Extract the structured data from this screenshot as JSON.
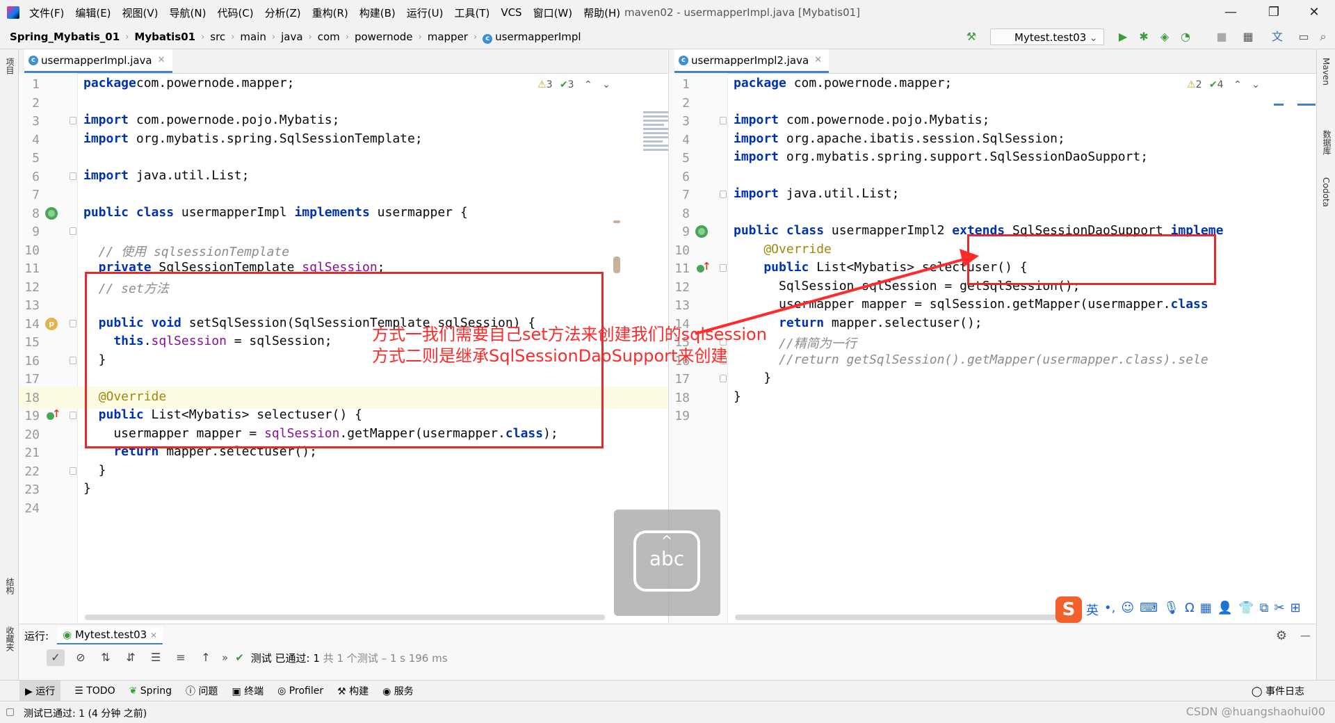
{
  "menubar": {
    "items": [
      "文件(F)",
      "编辑(E)",
      "视图(V)",
      "导航(N)",
      "代码(C)",
      "分析(Z)",
      "重构(R)",
      "构建(B)",
      "运行(U)",
      "工具(T)",
      "VCS",
      "窗口(W)",
      "帮助(H)"
    ],
    "title": "maven02 - usermapperImpl.java [Mybatis01]",
    "minimize": "—",
    "maximize": "❐",
    "close": "✕"
  },
  "breadcrumb": [
    "Spring_Mybatis_01",
    "Mybatis01",
    "src",
    "main",
    "java",
    "com",
    "powernode",
    "mapper",
    "usermapperImpl"
  ],
  "run_config": "Mytest.test03",
  "left_editor": {
    "tab": "usermapperImpl.java",
    "inspections": {
      "warnings": "3",
      "weak": "3"
    },
    "lines": [
      {
        "n": "1",
        "t": [
          [
            "kw",
            "package"
          ],
          [
            "",
            "com.powernode.mapper;"
          ]
        ]
      },
      {
        "n": "2",
        "t": []
      },
      {
        "n": "3",
        "t": [
          [
            "kw",
            "import"
          ],
          [
            "",
            " com.powernode.pojo.Mybatis;"
          ]
        ]
      },
      {
        "n": "4",
        "t": [
          [
            "kw",
            "import"
          ],
          [
            "",
            " org.mybatis.spring.SqlSessionTemplate;"
          ]
        ]
      },
      {
        "n": "5",
        "t": []
      },
      {
        "n": "6",
        "t": [
          [
            "kw",
            "import"
          ],
          [
            "",
            " java.util.List;"
          ]
        ]
      },
      {
        "n": "7",
        "t": []
      },
      {
        "n": "8",
        "t": [
          [
            "kw",
            "public class"
          ],
          [
            "",
            " usermapperImpl "
          ],
          [
            "kw",
            "implements"
          ],
          [
            "",
            " usermapper {"
          ]
        ]
      },
      {
        "n": "9",
        "t": []
      },
      {
        "n": "10",
        "t": [
          [
            "cm",
            "  // 使用 sqlsessionTemplate"
          ]
        ]
      },
      {
        "n": "11",
        "t": [
          [
            "kw",
            "  private"
          ],
          [
            "",
            " SqlSessionTemplate "
          ],
          [
            "fld",
            "sqlSession"
          ],
          [
            "",
            ";"
          ]
        ]
      },
      {
        "n": "12",
        "t": [
          [
            "cm",
            "  // set方法"
          ]
        ]
      },
      {
        "n": "13",
        "t": []
      },
      {
        "n": "14",
        "t": [
          [
            "kw",
            "  public void"
          ],
          [
            "",
            " setSqlSession(SqlSessionTemplate sqlSession) {"
          ]
        ]
      },
      {
        "n": "15",
        "t": [
          [
            "kw",
            "    this"
          ],
          [
            "",
            "."
          ],
          [
            "fld",
            "sqlSession"
          ],
          [
            "",
            " = sqlSession;"
          ]
        ]
      },
      {
        "n": "16",
        "t": [
          [
            "",
            "  }"
          ]
        ]
      },
      {
        "n": "17",
        "t": []
      },
      {
        "n": "18",
        "t": [
          [
            "an",
            "  @Override"
          ]
        ]
      },
      {
        "n": "19",
        "t": [
          [
            "kw",
            "  public"
          ],
          [
            "",
            " List<Mybatis> selectuser() {"
          ]
        ]
      },
      {
        "n": "20",
        "t": [
          [
            "",
            "    usermapper mapper = "
          ],
          [
            "fld",
            "sqlSession"
          ],
          [
            "",
            ".getMapper(usermapper."
          ],
          [
            "kw",
            "class"
          ],
          [
            "",
            ");"
          ]
        ]
      },
      {
        "n": "21",
        "t": [
          [
            "kw",
            "    return"
          ],
          [
            "",
            " mapper.selectuser();"
          ]
        ]
      },
      {
        "n": "22",
        "t": [
          [
            "",
            "  }"
          ]
        ]
      },
      {
        "n": "23",
        "t": [
          [
            "",
            "}"
          ]
        ]
      },
      {
        "n": "24",
        "t": []
      }
    ]
  },
  "right_editor": {
    "tab": "usermapperImpl2.java",
    "inspections": {
      "warnings": "2",
      "weak": "4"
    },
    "lines": [
      {
        "n": "1",
        "t": [
          [
            "kw",
            "package"
          ],
          [
            "",
            " com.powernode.mapper;"
          ]
        ]
      },
      {
        "n": "2",
        "t": []
      },
      {
        "n": "3",
        "t": [
          [
            "kw",
            "import"
          ],
          [
            "",
            " com.powernode.pojo.Mybatis;"
          ]
        ]
      },
      {
        "n": "4",
        "t": [
          [
            "kw",
            "import"
          ],
          [
            "",
            " org.apache.ibatis.session.SqlSession;"
          ]
        ]
      },
      {
        "n": "5",
        "t": [
          [
            "kw",
            "import"
          ],
          [
            "",
            " org.mybatis.spring.support.SqlSessionDaoSupport;"
          ]
        ]
      },
      {
        "n": "6",
        "t": []
      },
      {
        "n": "7",
        "t": [
          [
            "kw",
            "import"
          ],
          [
            "",
            " java.util.List;"
          ]
        ]
      },
      {
        "n": "8",
        "t": []
      },
      {
        "n": "9",
        "t": [
          [
            "kw",
            "public class"
          ],
          [
            "",
            " usermapperImpl2 "
          ],
          [
            "kw",
            "extends"
          ],
          [
            "",
            " SqlSessionDaoSupport "
          ],
          [
            "kw",
            "impleme"
          ]
        ]
      },
      {
        "n": "10",
        "t": [
          [
            "an",
            "    @Override"
          ]
        ]
      },
      {
        "n": "11",
        "t": [
          [
            "kw",
            "    public"
          ],
          [
            "",
            " List<Mybatis> selectuser() {"
          ]
        ]
      },
      {
        "n": "12",
        "t": [
          [
            "",
            "      SqlSession sqlSession = getSqlSession();"
          ]
        ]
      },
      {
        "n": "13",
        "t": [
          [
            "",
            "      usermapper mapper = sqlSession.getMapper(usermapper."
          ],
          [
            "kw",
            "class"
          ]
        ]
      },
      {
        "n": "14",
        "t": [
          [
            "kw",
            "      return"
          ],
          [
            "",
            " mapper.selectuser();"
          ]
        ]
      },
      {
        "n": "15",
        "t": [
          [
            "cm",
            "      //精简为一行"
          ]
        ]
      },
      {
        "n": "16",
        "t": [
          [
            "cm",
            "      //return getSqlSession().getMapper(usermapper.class).sele"
          ]
        ]
      },
      {
        "n": "17",
        "t": [
          [
            "",
            "    }"
          ]
        ]
      },
      {
        "n": "18",
        "t": [
          [
            "",
            "}"
          ]
        ]
      },
      {
        "n": "19",
        "t": []
      }
    ]
  },
  "annotation": {
    "line1": "方式一我们需要自己set方法来创建我们的sqlsession",
    "line2": "方式二则是继承SqlSessionDaoSupport来创建"
  },
  "ime": {
    "logo": "S",
    "lang": "英",
    "punct": "•,"
  },
  "overlay": {
    "text": "abc"
  },
  "side_labels": {
    "project": "项目",
    "structure": "结构",
    "favorites": "收藏夹",
    "maven": "Maven",
    "database": "数据库",
    "codota": "Codota"
  },
  "run_window": {
    "label": "运行:",
    "config": "Mytest.test03",
    "result_text": "测试 已通过:",
    "result_count": "1",
    "result_detail": "共 1 个测试 – 1 s 196 ms"
  },
  "tool_tabs": [
    "运行",
    "TODO",
    "Spring",
    "问题",
    "终端",
    "Profiler",
    "构建",
    "服务"
  ],
  "event_log": "事件日志",
  "status_text": "测试已通过: 1 (4 分钟 之前)",
  "watermark": "CSDN @huangshaohui00"
}
